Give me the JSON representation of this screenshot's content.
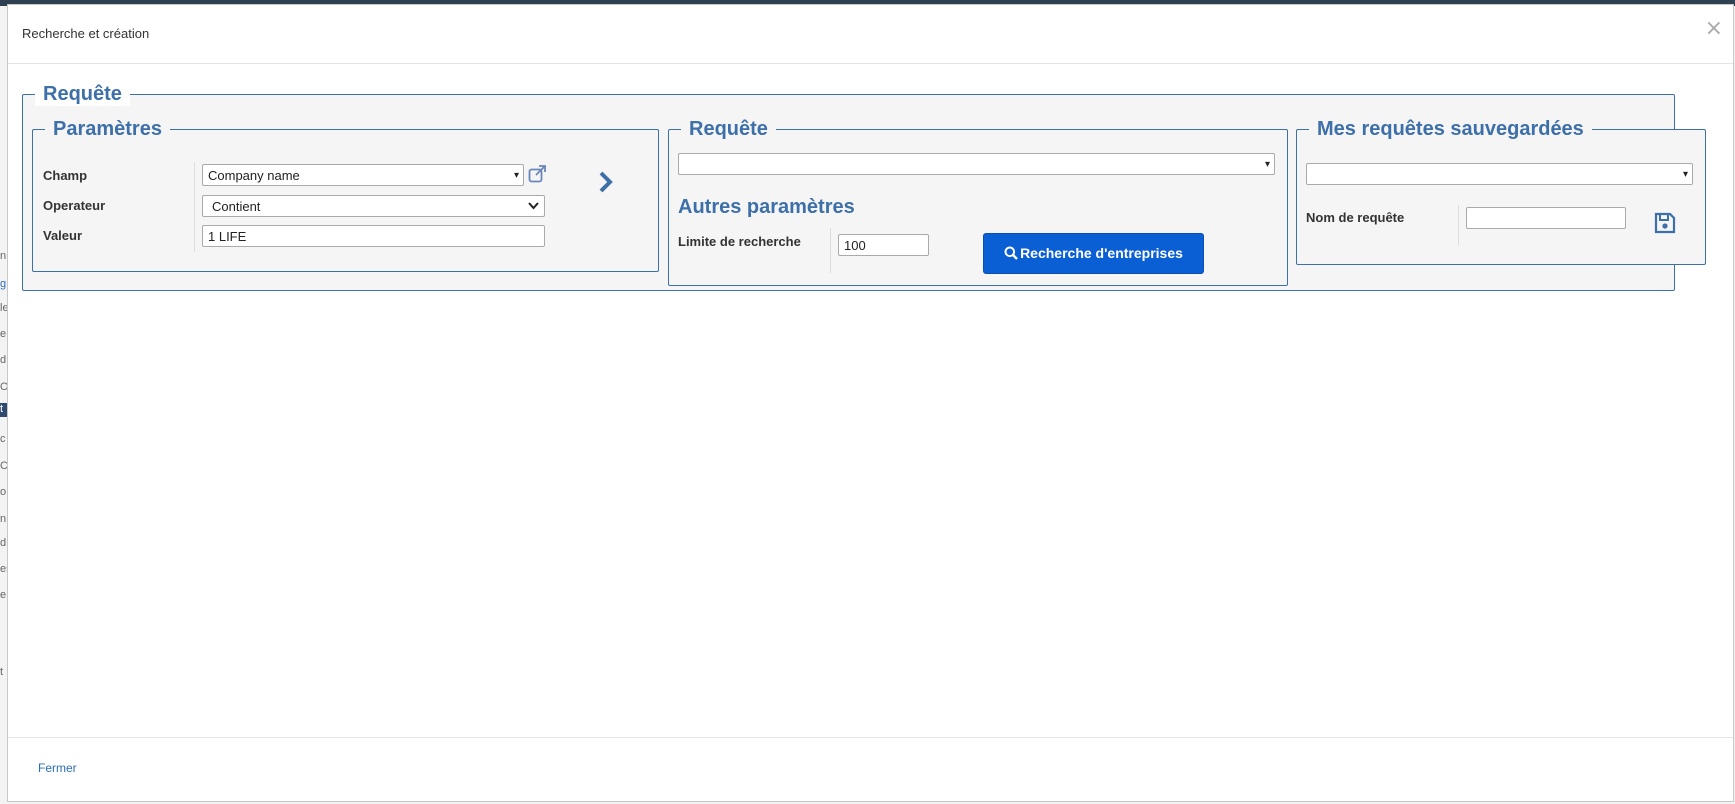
{
  "modal": {
    "title": "Recherche et création",
    "close_symbol": "×",
    "footer_close_label": "Fermer"
  },
  "outer_fieldset": {
    "legend": "Requête"
  },
  "parametres": {
    "legend": "Paramètres",
    "champ_label": "Champ",
    "champ_value": "Company name",
    "operateur_label": "Operateur",
    "operateur_value": "Contient",
    "valeur_label": "Valeur",
    "valeur_value": "1 LIFE"
  },
  "requete": {
    "legend": "Requête",
    "select_value": "",
    "autres_title": "Autres paramètres",
    "limite_label": "Limite de recherche",
    "limite_value": "100",
    "search_button_label": "Recherche d'entreprises"
  },
  "saved": {
    "legend": "Mes requêtes sauvegardées",
    "select_value": "",
    "nom_label": "Nom de requête",
    "nom_value": ""
  },
  "icons": {
    "external": "external-link-icon",
    "arrow": "chevron-right-icon",
    "search": "search-icon",
    "save": "floppy-disk-icon",
    "caret": "▾"
  },
  "colors": {
    "accent": "#3d6fa8",
    "button": "#0b5fd4",
    "link": "#2a6ebb"
  },
  "background_fragments": [
    "n",
    "g",
    "le",
    "e",
    "d",
    "O",
    "t",
    "c",
    "Ci",
    "o",
    "n",
    "d",
    "es",
    "e",
    "t"
  ]
}
